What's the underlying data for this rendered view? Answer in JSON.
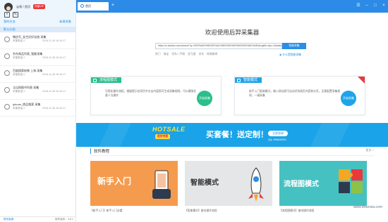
{
  "user": {
    "name": "云帆 / 首页",
    "vip": "升级VIP"
  },
  "sidebar": {
    "header": "我的任务",
    "sort": "新建采集",
    "group": "默认分组",
    "tasks": [
      {
        "name": "微信号_女生好好自拍 采集",
        "status": "采集数量  0",
        "date": "2018-11-28 16:16:17"
      },
      {
        "name": "京东商品列表_智能采集",
        "status": "采集数量  0",
        "date": "2018-11-28 16:16:17"
      },
      {
        "name": "百度搜索结果 上海 采集",
        "status": "采集数量  0",
        "date": "2018-11-28 16:16:17"
      },
      {
        "name": "当当网图书列表 采集",
        "status": "采集数量  0",
        "date": "2018-11-28 16:16:17"
      },
      {
        "name": "iphone_商品搜索 采集",
        "status": "采集数量  0",
        "date": "2018-11-28 16:16:17"
      }
    ],
    "footer_left": "联系客服",
    "footer_right": "软件版本：3.6.1"
  },
  "titlebar": {
    "tab": "首页"
  },
  "welcome": "欢迎使用后羿采集器",
  "search": {
    "url": "https://s.taobao.com/search?q=%E9%A6%96%E9%A1%B5%E6%95%B0%E6%8D%AE&imgfile=&js=1&stats_click=search_radio_all%3A1&initiative_id=staobaoz_20181128&ie=utf8",
    "go": "智能采集",
    "more": "什么是智能采集"
  },
  "hotlinks": [
    "热门",
    "淘宝",
    "京东二手商",
    "亚马逊",
    "京东",
    "网易新闻"
  ],
  "cards": {
    "flow": {
      "title": "流程图模式",
      "desc": "可视化操作流程，根据提示在网页中点击内容即可生成采集规则，可以模拟任意人为操作",
      "btn": "开始采集"
    },
    "smart": {
      "title": "智能模式",
      "desc": "新手入门智能模式，输入网址即可自动识别网页内容和分页，无需配置采集规则，一键采集",
      "btn": "开始采集"
    }
  },
  "banner": {
    "hot": "HOTSALE",
    "sub": "限时特惠",
    "title": "买套餐！送定制！",
    "btn": "立即咨询",
    "qq": "QQ: 2968432931"
  },
  "tutorial": {
    "title": "软件教程",
    "more": "更多 >",
    "items": [
      {
        "label": "新手入门",
        "caption": "【新手入门】新手入门必看"
      },
      {
        "label": "智能模式",
        "caption": "【智能模式】基本操作流程"
      },
      {
        "label": "流程图模式",
        "caption": "【流程图模式】基本操作流程"
      }
    ]
  },
  "watermark": "www.downxia.com",
  "colors": {
    "primary": "#2b8be6",
    "flow": "#2bbf8a",
    "smart": "#1fa4ea",
    "banner": "#1aa3e8",
    "orange": "#f59b4d",
    "gray": "#e4e6e8",
    "teal": "#46c1c2"
  }
}
